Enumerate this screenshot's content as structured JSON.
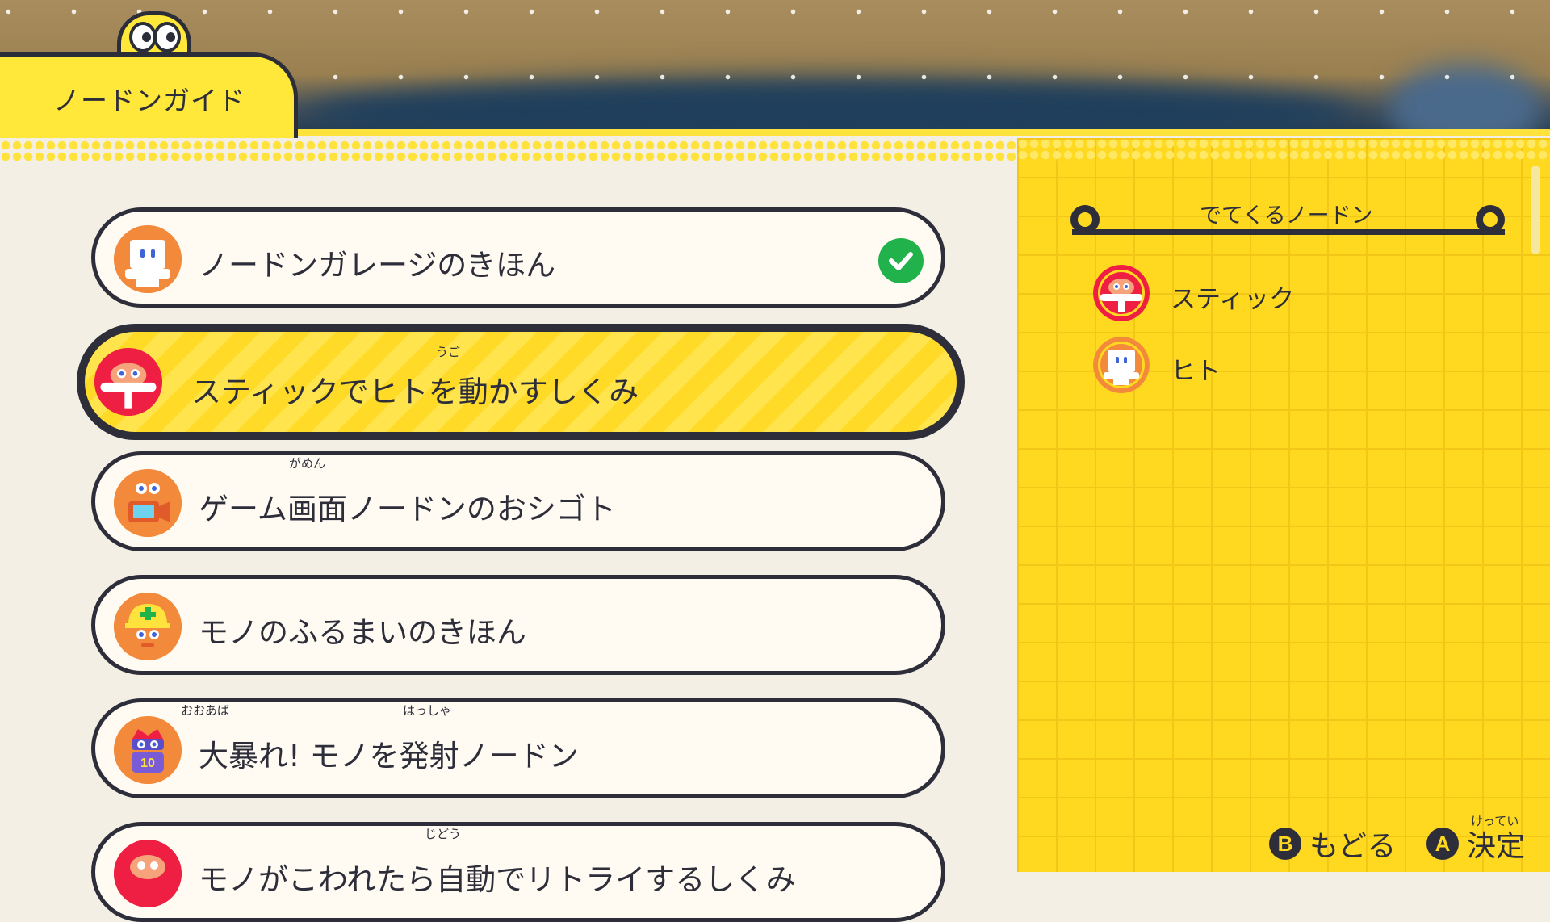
{
  "header": {
    "title": "ノードンガイド"
  },
  "guide_list": {
    "items": [
      {
        "label": "ノードンガレージのきほん",
        "icon": "hito-node-icon",
        "completed": true,
        "selected": false,
        "ruby": []
      },
      {
        "label": "スティックでヒトを動かすしくみ",
        "icon": "stick-node-icon",
        "completed": false,
        "selected": true,
        "ruby": [
          "うご"
        ]
      },
      {
        "label": "ゲーム画面ノードンのおシゴト",
        "icon": "game-screen-node-icon",
        "completed": false,
        "selected": false,
        "ruby": [
          "がめん"
        ]
      },
      {
        "label": "モノのふるまいのきほん",
        "icon": "object-node-icon",
        "completed": false,
        "selected": false,
        "ruby": []
      },
      {
        "label": "大暴れ! モノを発射ノードン",
        "icon": "launcher-node-icon",
        "completed": false,
        "selected": false,
        "ruby": [
          "おおあば",
          "はっしゃ"
        ]
      },
      {
        "label": "モノがこわれたら自動でリトライするしくみ",
        "icon": "stick-node-icon",
        "completed": false,
        "selected": false,
        "ruby": [
          "じどう"
        ]
      }
    ]
  },
  "nodes_panel": {
    "title": "でてくるノードン",
    "nodes": [
      {
        "label": "スティック",
        "icon": "stick-node-icon"
      },
      {
        "label": "ヒト",
        "icon": "hito-node-icon"
      }
    ]
  },
  "footer": {
    "back": {
      "button": "B",
      "label": "もどる"
    },
    "confirm": {
      "button": "A",
      "label": "決定",
      "ruby": "けってい"
    }
  },
  "colors": {
    "accent_yellow": "#ffd91f",
    "outline": "#2d2e3a",
    "check_green": "#21b24b",
    "stick_red": "#ef1f43",
    "node_orange": "#f3893b"
  }
}
